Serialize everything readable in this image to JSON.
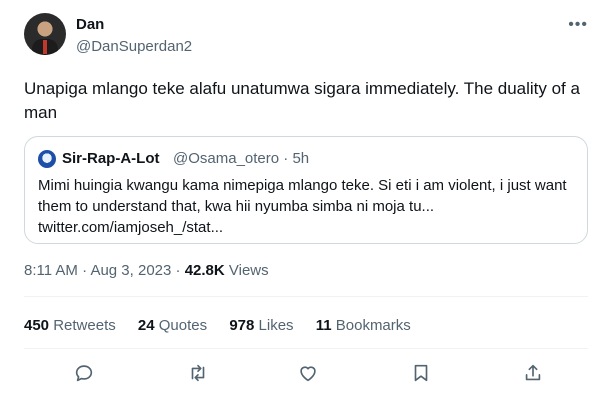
{
  "author": {
    "name": "Dan",
    "handle": "@DanSuperdan2"
  },
  "tweet": {
    "text": "Unapiga mlango teke alafu unatumwa sigara immediately. The duality of a man"
  },
  "quote": {
    "name": "Sir-Rap-A-Lot",
    "handle": "@Osama_otero",
    "separator": "·",
    "age": "5h",
    "text": "Mimi huingia kwangu kama nimepiga mlango teke. Si eti i am violent, i just want them to understand that, kwa hii nyumba simba ni moja tu... twitter.com/iamjoseh_/stat..."
  },
  "meta": {
    "time": "8:11 AM",
    "dot1": "·",
    "date": "Aug 3, 2023",
    "dot2": "·",
    "views_count": "42.8K",
    "views_label": "Views"
  },
  "stats": {
    "retweets_count": "450",
    "retweets_label": "Retweets",
    "quotes_count": "24",
    "quotes_label": "Quotes",
    "likes_count": "978",
    "likes_label": "Likes",
    "bookmarks_count": "11",
    "bookmarks_label": "Bookmarks"
  },
  "icons": {
    "more": "more-dots-icon",
    "reply": "reply-icon",
    "retweet": "retweet-icon",
    "like": "heart-icon",
    "bookmark": "bookmark-icon",
    "share": "share-icon"
  },
  "colors": {
    "text_primary": "#0f1419",
    "text_secondary": "#536471",
    "border": "#cfd9de"
  }
}
